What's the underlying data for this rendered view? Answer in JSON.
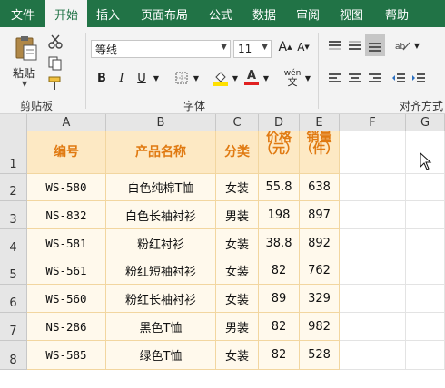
{
  "ribbon": {
    "tabs": [
      "文件",
      "开始",
      "插入",
      "页面布局",
      "公式",
      "数据",
      "审阅",
      "视图",
      "帮助"
    ],
    "active_tab": "开始",
    "clipboard": {
      "paste_label": "粘贴",
      "group_label": "剪贴板"
    },
    "font": {
      "font_name": "等线",
      "font_size": "11",
      "group_label": "字体",
      "bold": "B",
      "italic": "I",
      "underline": "U",
      "font_color_letter": "A",
      "phonetic": "wén"
    },
    "alignment": {
      "group_label": "对齐方式"
    }
  },
  "grid": {
    "columns": [
      "A",
      "B",
      "C",
      "D",
      "E",
      "F",
      "G"
    ],
    "rows": [
      "1",
      "2",
      "3",
      "4",
      "5",
      "6",
      "7",
      "8"
    ],
    "headers": [
      "编号",
      "产品名称",
      "分类",
      "价格（元）",
      "销量（件）"
    ],
    "data": [
      [
        "WS-580",
        "白色纯棉T恤",
        "女装",
        "55.8",
        "638"
      ],
      [
        "NS-832",
        "白色长袖衬衫",
        "男装",
        "198",
        "897"
      ],
      [
        "WS-581",
        "粉红衬衫",
        "女装",
        "38.8",
        "892"
      ],
      [
        "WS-561",
        "粉红短袖衬衫",
        "女装",
        "82",
        "762"
      ],
      [
        "WS-560",
        "粉红长袖衬衫",
        "女装",
        "89",
        "329"
      ],
      [
        "NS-286",
        "黑色T恤",
        "男装",
        "82",
        "982"
      ],
      [
        "WS-585",
        "绿色T恤",
        "女装",
        "82",
        "528"
      ]
    ]
  },
  "colors": {
    "accent": "#217346",
    "header_fill": "#fde9c4",
    "header_text": "#e07a12",
    "data_fill": "#fff9ec"
  }
}
